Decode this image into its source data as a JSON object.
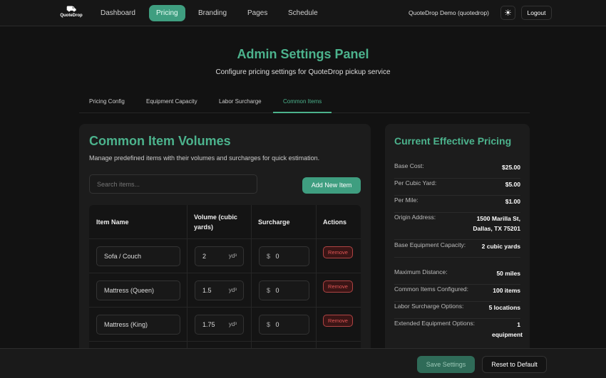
{
  "nav": {
    "logo_text": "QuoteDrop",
    "items": [
      "Dashboard",
      "Pricing",
      "Branding",
      "Pages",
      "Schedule"
    ],
    "user": "QuoteDrop Demo (quotedrop)",
    "logout": "Logout"
  },
  "header": {
    "title": "Admin Settings Panel",
    "subtitle": "Configure pricing settings for QuoteDrop pickup service"
  },
  "tabs": [
    "Pricing Config",
    "Equipment Capacity",
    "Labor Surcharge",
    "Common Items"
  ],
  "common": {
    "title": "Common Item Volumes",
    "description": "Manage predefined items with their volumes and surcharges for quick estimation.",
    "search_placeholder": "Search items...",
    "add_label": "Add New Item",
    "columns": [
      "Item Name",
      "Volume (cubic yards)",
      "Surcharge",
      "Actions"
    ],
    "unit": "yd³",
    "currency": "$",
    "remove_label": "Remove",
    "rows": [
      {
        "name": "Sofa / Couch",
        "volume": "2",
        "surcharge": "0"
      },
      {
        "name": "Mattress (Queen)",
        "volume": "1.5",
        "surcharge": "0"
      },
      {
        "name": "Mattress (King)",
        "volume": "1.75",
        "surcharge": "0"
      }
    ]
  },
  "pricing": {
    "title": "Current Effective Pricing",
    "rows": [
      {
        "k": "Base Cost:",
        "v": "$25.00"
      },
      {
        "k": "Per Cubic Yard:",
        "v": "$5.00"
      },
      {
        "k": "Per Mile:",
        "v": "$1.00"
      },
      {
        "k": "Origin Address:",
        "v": "1500 Marilla St, Dallas, TX 75201"
      },
      {
        "k": "Base Equipment Capacity:",
        "v": "2 cubic yards"
      },
      {
        "k": "Maximum Distance:",
        "v": "50 miles"
      },
      {
        "k": "Common Items Configured:",
        "v": "100 items"
      },
      {
        "k": "Labor Surcharge Options:",
        "v": "5 locations"
      },
      {
        "k": "Extended Equipment Options:",
        "v": "1 equipment"
      }
    ]
  },
  "footer": {
    "save": "Save Settings",
    "reset": "Reset to Default"
  }
}
